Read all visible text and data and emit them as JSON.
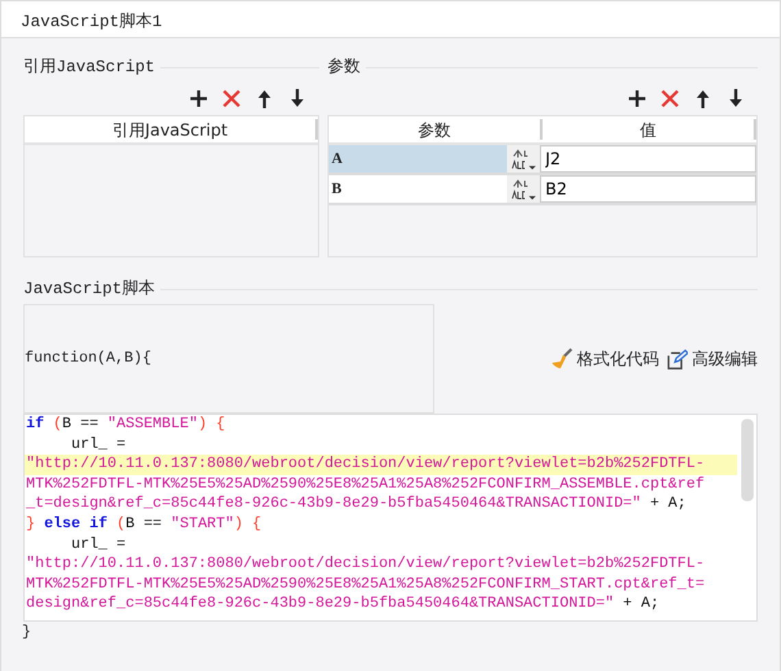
{
  "window": {
    "title": "JavaScript脚本1"
  },
  "imports": {
    "title": "引用JavaScript",
    "toolbar": [
      {
        "kind": "add"
      },
      {
        "kind": "delete"
      },
      {
        "kind": "up"
      },
      {
        "kind": "down"
      }
    ],
    "columns": [
      "引用JavaScript"
    ]
  },
  "params": {
    "title": "参数",
    "toolbar": [
      {
        "kind": "add"
      },
      {
        "kind": "delete"
      },
      {
        "kind": "up"
      },
      {
        "kind": "down"
      }
    ],
    "columns": [
      "参数",
      "值"
    ],
    "rows": [
      {
        "name": "A",
        "value": "J2",
        "selected": true
      },
      {
        "name": "B",
        "value": "B2",
        "selected": false
      }
    ]
  },
  "script": {
    "title": "JavaScript脚本",
    "signature": "function(A,B){",
    "format_button": "格式化代码",
    "edit_button": "高级编辑",
    "lines": [
      {
        "current": false,
        "tokens": [
          {
            "kind": "keyword",
            "text": "if"
          },
          {
            "kind": "bracket",
            "text": " ("
          },
          {
            "kind": "plain",
            "text": "B == "
          },
          {
            "kind": "string",
            "text": "\"ASSEMBLE\""
          },
          {
            "kind": "bracket",
            "text": ") {"
          }
        ]
      },
      {
        "current": false,
        "tokens": [
          {
            "kind": "plain",
            "text": "     url_ ="
          }
        ]
      },
      {
        "current": true,
        "tokens": [
          {
            "kind": "string",
            "text": "\"http://10.11.0.137:8080/webroot/decision/view/report?viewlet=b2b%252FDTFL-"
          }
        ]
      },
      {
        "current": false,
        "tokens": [
          {
            "kind": "string",
            "text": "MTK%252FDTFL-MTK%25E5%25AD%2590%25E8%25A1%25A8%252FCONFIRM_ASSEMBLE.cpt&ref"
          }
        ]
      },
      {
        "current": false,
        "tokens": [
          {
            "kind": "string",
            "text": "_t=design&ref_c=85c44fe8-926c-43b9-8e29-b5fba5450464&TRANSACTIONID=\""
          },
          {
            "kind": "plain",
            "text": " + A;"
          }
        ]
      },
      {
        "current": false,
        "tokens": [
          {
            "kind": "bracket",
            "text": "}"
          },
          {
            "kind": "keyword",
            "text": " else if"
          },
          {
            "kind": "bracket",
            "text": " ("
          },
          {
            "kind": "plain",
            "text": "B == "
          },
          {
            "kind": "string",
            "text": "\"START\""
          },
          {
            "kind": "bracket",
            "text": ") {"
          }
        ]
      },
      {
        "current": false,
        "tokens": [
          {
            "kind": "plain",
            "text": "     url_ ="
          }
        ]
      },
      {
        "current": false,
        "tokens": [
          {
            "kind": "string",
            "text": "\"http://10.11.0.137:8080/webroot/decision/view/report?viewlet=b2b%252FDTFL-"
          }
        ]
      },
      {
        "current": false,
        "tokens": [
          {
            "kind": "string",
            "text": "MTK%252FDTFL-MTK%25E5%25AD%2590%25E8%25A1%25A8%252FCONFIRM_START.cpt&ref_t="
          }
        ]
      },
      {
        "current": false,
        "tokens": [
          {
            "kind": "string",
            "text": "design&ref_c=85c44fe8-926c-43b9-8e29-b5fba5450464&TRANSACTIONID=\""
          },
          {
            "kind": "plain",
            "text": " + A;"
          }
        ]
      }
    ],
    "closing": "}"
  }
}
